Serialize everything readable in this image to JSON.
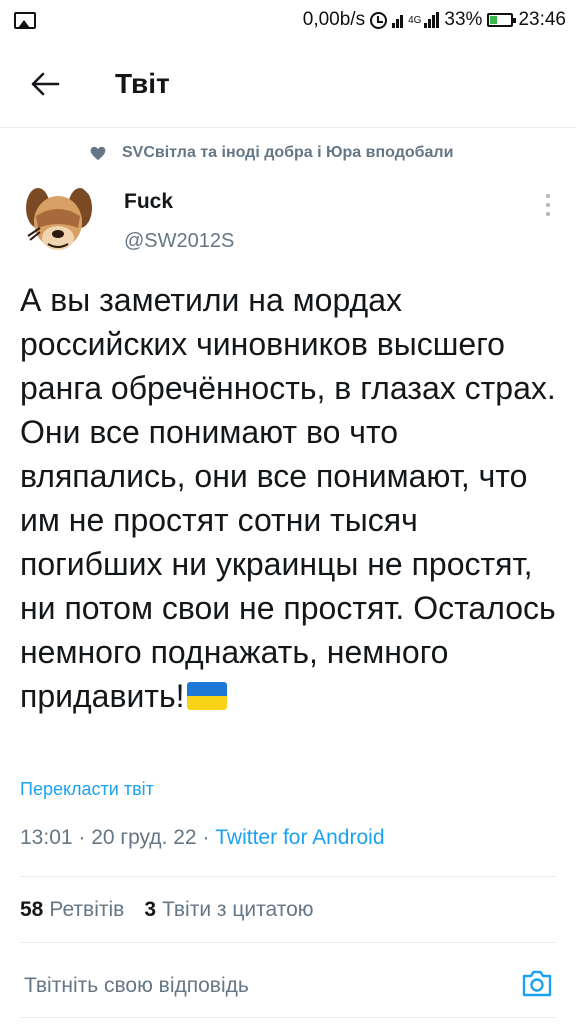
{
  "status_bar": {
    "speed": "0,00b/s",
    "network": "4G",
    "battery_percent": "33%",
    "battery_level": 0.33,
    "time": "23:46"
  },
  "header": {
    "title": "Твіт"
  },
  "social_context": "SVСвітла та іноді добра і Юра вподобали",
  "author": {
    "display_name": "Fuck",
    "handle": "@SW2012S"
  },
  "tweet": {
    "text": "А вы заметили на мордах российских чиновников высшего ранга обречённость, в глазах страх. Они все понимают во что вляпались, они все понимают, что им не простят сотни тысяч погибших ни украинцы не простят, ни потом свои не простят. Осталось немного поднажать, немного придавить!",
    "flag_colors": [
      "#1e78d6",
      "#f8d316"
    ],
    "translate_label": "Перекласти твіт",
    "timestamp": "13:01 · 20 груд. 22 · ",
    "source": "Twitter for Android"
  },
  "stats": {
    "retweets_count": "58",
    "retweets_label": "Ретвітів",
    "quotes_count": "3",
    "quotes_label": "Твіти з цитатою"
  },
  "reply": {
    "placeholder": "Твітніть свою відповідь"
  },
  "colors": {
    "accent": "#1da1f2",
    "secondary_text": "#657786",
    "divider": "#e6ecf0"
  }
}
